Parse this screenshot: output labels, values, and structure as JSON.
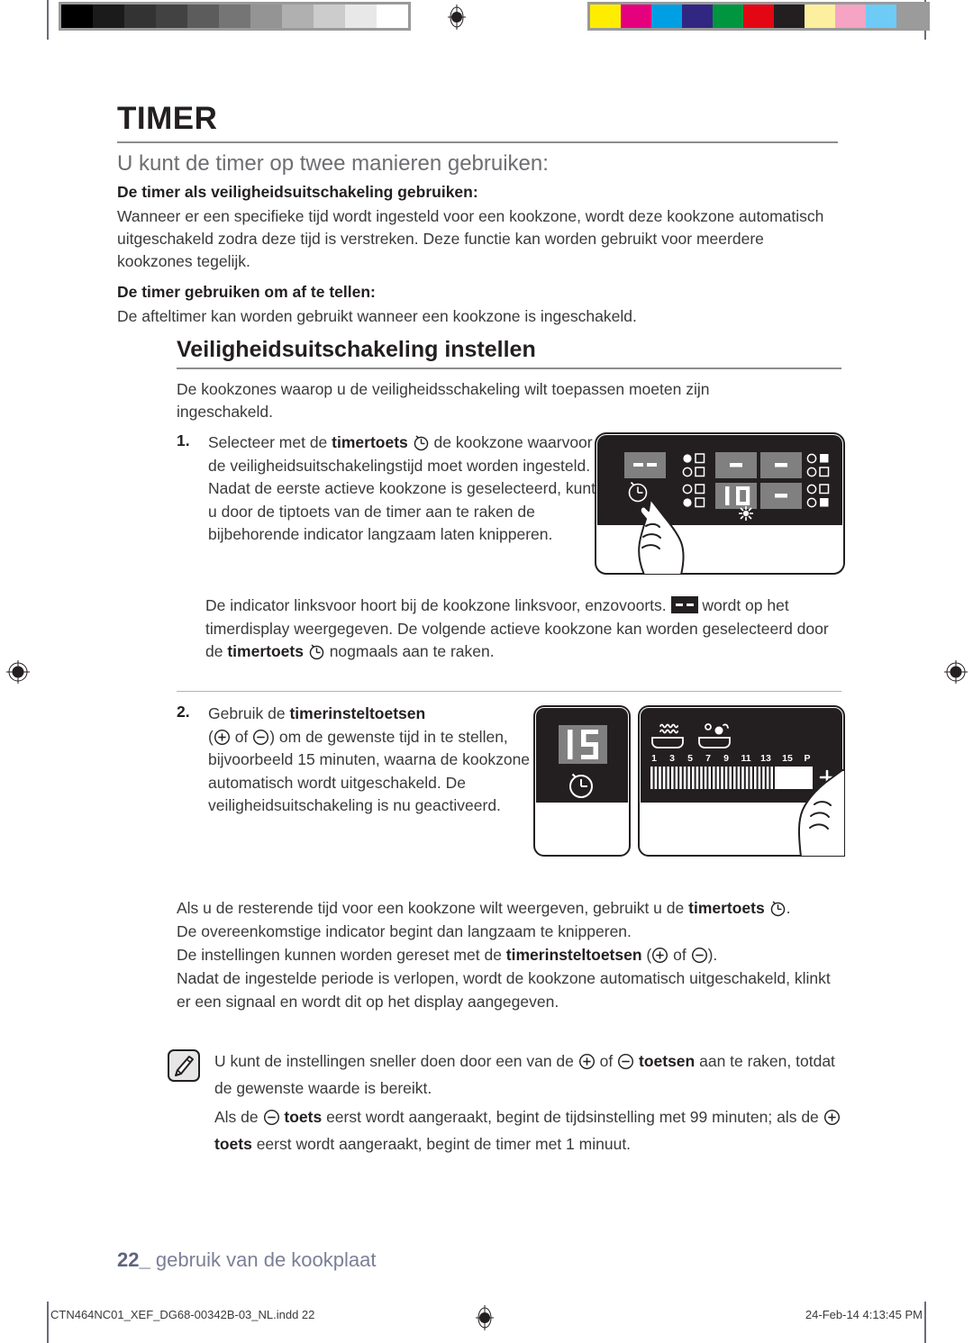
{
  "calibration": {
    "gray_steps": [
      "#000000",
      "#1b1b1b",
      "#333333",
      "#424242",
      "#5c5c5c",
      "#757575",
      "#949494",
      "#b0b0b0",
      "#cccccc",
      "#e8e8e8",
      "#ffffff"
    ],
    "colors": [
      "#ffed00",
      "#e5007e",
      "#009fe3",
      "#312783",
      "#009640",
      "#e30613",
      "#231f20",
      "#fcf0a0",
      "#f6a4c4",
      "#6ecbf5",
      "#9b9b9b"
    ]
  },
  "header": {
    "title": "TIMER",
    "subtitle": "U kunt de timer op twee manieren gebruiken:"
  },
  "intro_blocks": [
    {
      "heading": "De timer als veiligheidsuitschakeling gebruiken:",
      "body": "Wanneer er een specifieke tijd wordt ingesteld voor een kookzone, wordt deze kookzone automatisch uitgeschakeld zodra deze tijd is verstreken. Deze functie kan worden gebruikt voor meerdere kookzones tegelijk."
    },
    {
      "heading": "De timer gebruiken om af te tellen:",
      "body": "De afteltimer kan worden gebruikt wanneer een kookzone is ingeschakeld."
    }
  ],
  "section": {
    "title": "Veiligheidsuitschakeling instellen",
    "intro": "De kookzones waarop u de veiligheidsschakeling wilt toepassen moeten zijn ingeschakeld."
  },
  "steps": [
    {
      "number": "1.",
      "lead": "Selecteer met de",
      "bold_1": "timertoets",
      "after_icon": "de kookzone waarvoor de veiligheidsuitschakelingstijd moet worden ingesteld.",
      "extra": "Nadat de eerste actieve kookzone is geselecteerd, kunt u door de tiptoets van de timer aan te raken de bijbehorende indicator langzaam laten knipperen."
    },
    {
      "number": "2.",
      "lead": "Gebruik de",
      "bold_1": "timerinsteltoetsen",
      "paren_open": "(",
      "of": "of",
      "paren_close": ")",
      "after_icons": "om de gewenste tijd in te stellen, bijvoorbeeld 15 minuten, waarna de kookzone automatisch wordt uitgeschakeld.",
      "extra": "De veiligheidsuitschakeling is nu geactiveerd."
    }
  ],
  "mid_text": {
    "line_1a": "De indicator linksvoor hoort bij de kookzone linksvoor, enzovoorts.",
    "line_1b": "wordt op het timerdisplay weergegeven.",
    "line_2a": "De volgende actieve kookzone kan worden geselecteerd door de",
    "line_2b": "timertoets",
    "line_2c": "nogmaals aan te raken."
  },
  "tail_text": {
    "p1a": "Als u de resterende tijd voor een kookzone wilt weergeven, gebruikt u de",
    "p1b": "timertoets",
    "p1c": ".",
    "p2": "De overeenkomstige indicator begint dan langzaam te knipperen.",
    "p3a": "De instellingen kunnen worden gereset met de",
    "p3b": "timerinsteltoetsen",
    "p3_of": "of",
    "p4": "Nadat de ingestelde periode is verlopen, wordt de kookzone automatisch uitgeschakeld, klinkt er een signaal en wordt dit op het display aangegeven."
  },
  "note": {
    "icon": "note-pencil-icon",
    "l1a": "U kunt de instellingen sneller doen door een van de",
    "l1_of": "of",
    "l1b": "toetsen",
    "l1c": "aan te raken, totdat de gewenste waarde is bereikt.",
    "l2a": "Als de",
    "l2b": "toets",
    "l2c": "eerst wordt aangeraakt, begint de tijdsinstelling met 99 minuten; als de",
    "l2d": "toets",
    "l2e": "eerst wordt aangeraakt, begint de timer met 1 minuut."
  },
  "footer": {
    "page_number": "22",
    "underscore": "_",
    "caption": "gebruik van de kookplaat",
    "imprint_file": "CTN464NC01_XEF_DG68-00342B-03_NL.indd   22",
    "imprint_date": "24-Feb-14   4:13:45 PM"
  },
  "illustration_1": {
    "name": "hob-control-panel-timer-select",
    "timer_display": "--",
    "zone_displays": [
      "-",
      "-",
      "10",
      "-"
    ],
    "touch_target": "timer-key"
  },
  "illustration_2": {
    "left_panel": {
      "name": "timer-display-panel",
      "display_value": "15",
      "key": "timer-key"
    },
    "right_panel": {
      "name": "power-slider-panel",
      "scale_labels": [
        "1",
        "3",
        "5",
        "7",
        "9",
        "11",
        "13",
        "15",
        "P"
      ],
      "plus_label": "+",
      "pan_icons": [
        "heat-pan-icon",
        "boil-pan-icon"
      ]
    }
  }
}
